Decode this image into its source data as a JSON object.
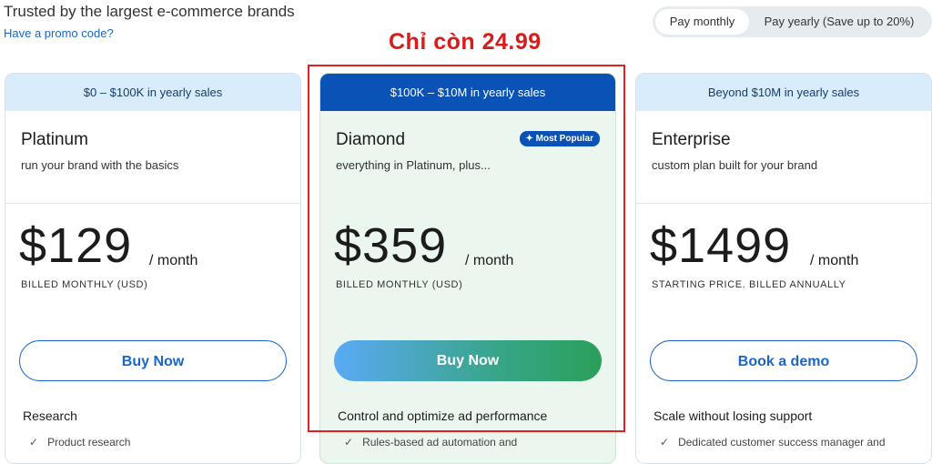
{
  "header": {
    "trusted": "Trusted by the largest e-commerce brands",
    "promo_link": "Have a promo code?"
  },
  "billing_toggle": {
    "monthly": "Pay monthly",
    "yearly": "Pay yearly (Save up to 20%)",
    "selected": "monthly"
  },
  "promo_note": "Chỉ còn 24.99",
  "plans": [
    {
      "band": "$0 – $100K in yearly sales",
      "name": "Platinum",
      "desc": "run your brand with the basics",
      "price": "$129",
      "per": "/ month",
      "billed": "BILLED MONTHLY  (USD)",
      "cta": "Buy Now",
      "features_heading": "Research",
      "feature_1": "Product research"
    },
    {
      "band": "$100K – $10M in yearly sales",
      "name": "Diamond",
      "badge": "Most Popular",
      "desc": "everything in Platinum, plus...",
      "price": "$359",
      "per": "/ month",
      "billed": "BILLED MONTHLY  (USD)",
      "cta": "Buy Now",
      "features_heading": "Control and optimize ad performance",
      "feature_1": "Rules-based ad automation and"
    },
    {
      "band": "Beyond $10M in yearly sales",
      "name": "Enterprise",
      "desc": "custom plan built for your brand",
      "price": "$1499",
      "per": "/ month",
      "billed": "STARTING PRICE. BILLED ANNUALLY",
      "cta": "Book a demo",
      "features_heading": "Scale without losing support",
      "feature_1": "Dedicated customer success manager and"
    }
  ],
  "colors": {
    "accent": "#1a66c8",
    "featured_band": "#0a52b5",
    "band": "#d9ecfb",
    "featured_bg": "#ebf6ef",
    "promo_red": "#d81b1b"
  },
  "icons": {
    "check": "✓",
    "sparkle": "✦"
  }
}
